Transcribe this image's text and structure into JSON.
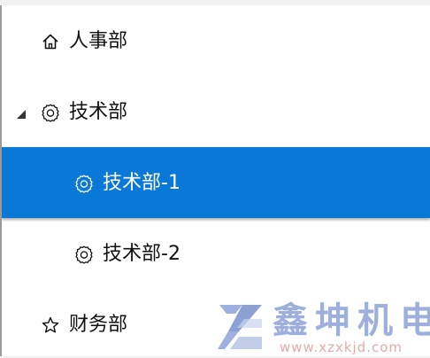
{
  "tree": {
    "items": [
      {
        "label": "人事部",
        "icon": "home-icon",
        "selected": false
      },
      {
        "label": "技术部",
        "icon": "gear-icon",
        "expanded": true,
        "selected": false
      },
      {
        "label": "技术部-1",
        "icon": "gear-icon",
        "selected": true
      },
      {
        "label": "技术部-2",
        "icon": "gear-icon",
        "selected": false
      },
      {
        "label": "财务部",
        "icon": "star-icon",
        "selected": false
      }
    ]
  },
  "watermark": {
    "brand": "鑫坤机电",
    "url": "www.xzxkjd.com"
  },
  "colors": {
    "selection": "#0a78d7",
    "text": "#111111",
    "selected_text": "#ffffff",
    "watermark_text": "#8ca2d8",
    "watermark_url": "#e2a0a0"
  }
}
